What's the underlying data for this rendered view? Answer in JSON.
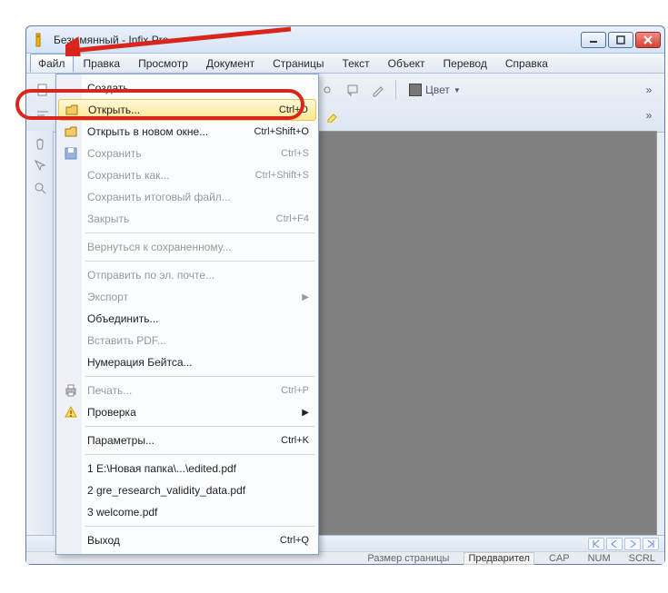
{
  "window": {
    "title": "Безымянный - Infix Pro"
  },
  "menubar": [
    "Файл",
    "Правка",
    "Просмотр",
    "Документ",
    "Страницы",
    "Текст",
    "Объект",
    "Перевод",
    "Справка"
  ],
  "toolbar_color_label": "Цвет",
  "dropdown": {
    "items": [
      {
        "label": "Создать...",
        "shortcut": "",
        "enabled": true,
        "type": "item"
      },
      {
        "label": "Открыть...",
        "shortcut": "Ctrl+O",
        "enabled": true,
        "icon": "open",
        "highlight": true,
        "type": "item"
      },
      {
        "label": "Открыть в новом окне...",
        "shortcut": "Ctrl+Shift+O",
        "enabled": true,
        "icon": "open",
        "type": "item"
      },
      {
        "label": "Сохранить",
        "shortcut": "Ctrl+S",
        "enabled": false,
        "icon": "save",
        "type": "item"
      },
      {
        "label": "Сохранить как...",
        "shortcut": "Ctrl+Shift+S",
        "enabled": false,
        "type": "item"
      },
      {
        "label": "Сохранить итоговый файл...",
        "shortcut": "",
        "enabled": false,
        "type": "item"
      },
      {
        "label": "Закрыть",
        "shortcut": "Ctrl+F4",
        "enabled": false,
        "type": "item"
      },
      {
        "type": "sep"
      },
      {
        "label": "Вернуться к сохраненному...",
        "shortcut": "",
        "enabled": false,
        "type": "item"
      },
      {
        "type": "sep"
      },
      {
        "label": "Отправить по эл. почте...",
        "shortcut": "",
        "enabled": false,
        "type": "item"
      },
      {
        "label": "Экспорт",
        "shortcut": "",
        "enabled": false,
        "type": "submenu"
      },
      {
        "label": "Объединить...",
        "shortcut": "",
        "enabled": true,
        "type": "item"
      },
      {
        "label": "Вставить PDF...",
        "shortcut": "",
        "enabled": false,
        "type": "item"
      },
      {
        "label": "Нумерация Бейтса...",
        "shortcut": "",
        "enabled": true,
        "type": "item"
      },
      {
        "type": "sep"
      },
      {
        "label": "Печать...",
        "shortcut": "Ctrl+P",
        "enabled": false,
        "icon": "print",
        "type": "item"
      },
      {
        "label": "Проверка",
        "shortcut": "",
        "enabled": true,
        "icon": "warn",
        "type": "submenu"
      },
      {
        "type": "sep"
      },
      {
        "label": "Параметры...",
        "shortcut": "Ctrl+K",
        "enabled": true,
        "type": "item"
      },
      {
        "type": "sep"
      },
      {
        "label": "1 E:\\Новая папка\\...\\edited.pdf",
        "shortcut": "",
        "enabled": true,
        "type": "item"
      },
      {
        "label": "2 gre_research_validity_data.pdf",
        "shortcut": "",
        "enabled": true,
        "type": "item"
      },
      {
        "label": "3 welcome.pdf",
        "shortcut": "",
        "enabled": true,
        "type": "item"
      },
      {
        "type": "sep"
      },
      {
        "label": "Выход",
        "shortcut": "Ctrl+Q",
        "enabled": true,
        "type": "item"
      }
    ]
  },
  "status": {
    "page_size": "Размер страницы",
    "preview": "Предварител",
    "cap": "CAP",
    "num": "NUM",
    "scrl": "SCRL"
  }
}
